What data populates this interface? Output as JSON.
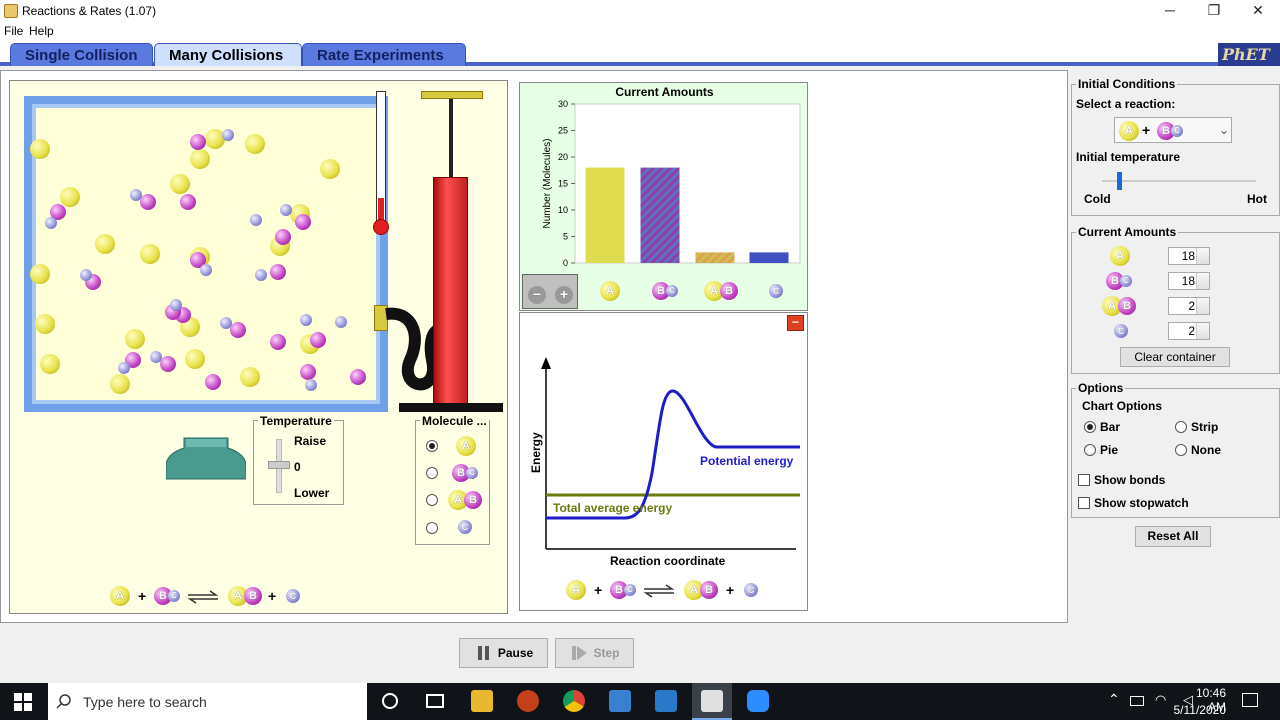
{
  "window": {
    "title": "Reactions & Rates (1.07)",
    "minimize": "─",
    "restore": "❐",
    "close": "✕"
  },
  "menu": [
    "File",
    "Help"
  ],
  "tabs": [
    {
      "label": "Single Collision",
      "active": false
    },
    {
      "label": "Many Collisions",
      "active": true
    },
    {
      "label": "Rate Experiments",
      "active": false
    }
  ],
  "logo": "PhET",
  "temperature_control": {
    "title": "Temperature",
    "raise": "Raise",
    "value": "0",
    "lower": "Lower"
  },
  "molecule_selector": {
    "title": "Molecule ...",
    "options": [
      "A",
      "BC",
      "AB",
      "C"
    ],
    "selected": 0
  },
  "reaction_equation": {
    "reactant1": "A",
    "reactant2": "BC",
    "product1": "AB",
    "product2": "C"
  },
  "bar_chart_panel": {
    "title": "Current Amounts",
    "zoom_out": "−",
    "zoom_in": "+"
  },
  "chart_data": {
    "type": "bar",
    "title": "Current Amounts",
    "ylabel": "Number (Molecules)",
    "ylim": [
      0,
      30
    ],
    "yticks": [
      "0",
      "5",
      "10",
      "15",
      "20",
      "25",
      "30"
    ],
    "categories": [
      "A",
      "BC",
      "AB",
      "C"
    ],
    "values": [
      18,
      18,
      2,
      2
    ],
    "colors": [
      "#e0dc50",
      "#9040a0",
      "#e0a050",
      "#4050c0"
    ]
  },
  "energy_diagram": {
    "ylabel": "Energy",
    "xlabel": "Reaction coordinate",
    "potential_label": "Potential energy",
    "total_label": "Total average energy",
    "potential_color": "#1c1cc8",
    "total_color": "#6b7a10"
  },
  "right_panel": {
    "initial_conditions": {
      "title": "Initial Conditions",
      "select_label": "Select a reaction:",
      "temperature_label": "Initial temperature",
      "cold": "Cold",
      "hot": "Hot",
      "temperature_level": 0.1
    },
    "current_amounts": {
      "title": "Current Amounts",
      "rows": [
        {
          "molecule": "A",
          "value": "18"
        },
        {
          "molecule": "BC",
          "value": "18"
        },
        {
          "molecule": "AB",
          "value": "2"
        },
        {
          "molecule": "C",
          "value": "2"
        }
      ],
      "clear_button": "Clear container"
    },
    "options": {
      "title": "Options",
      "chart_options": "Chart Options",
      "radios": [
        {
          "label": "Bar",
          "checked": true
        },
        {
          "label": "Strip",
          "checked": false
        },
        {
          "label": "Pie",
          "checked": false
        },
        {
          "label": "None",
          "checked": false
        }
      ],
      "show_bonds": "Show bonds",
      "show_stopwatch": "Show stopwatch"
    },
    "reset_button": "Reset All"
  },
  "controls": {
    "pause": "Pause",
    "step": "Step"
  },
  "taskbar": {
    "search_placeholder": "Type here to search",
    "time": "10:46 AM",
    "date": "5/11/2020"
  }
}
